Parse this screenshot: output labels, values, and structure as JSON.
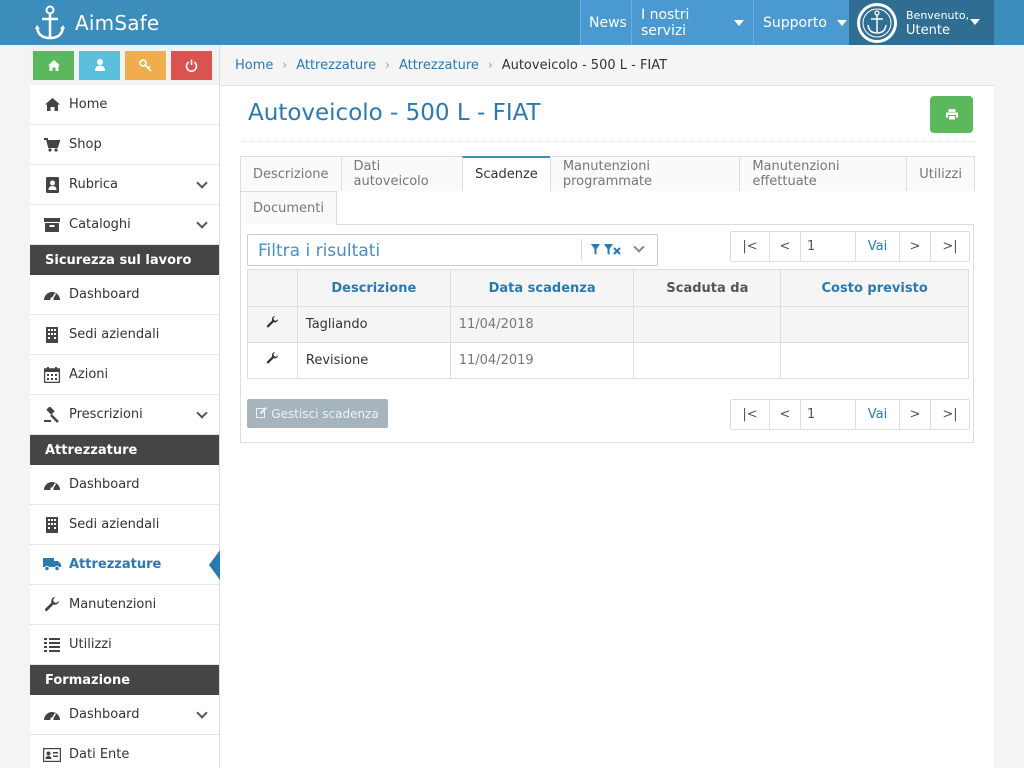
{
  "app": {
    "title": "AimSafe"
  },
  "topnav": {
    "items": [
      {
        "label": "News",
        "dropdown": false
      },
      {
        "label": "I nostri servizi",
        "dropdown": true
      },
      {
        "label": "Supporto",
        "dropdown": true
      }
    ],
    "user": {
      "greeting": "Benvenuto,",
      "name": "Utente"
    }
  },
  "quick_buttons": [
    {
      "icon": "home-icon",
      "color": "#5cb85c"
    },
    {
      "icon": "user-icon",
      "color": "#5bc0de"
    },
    {
      "icon": "key-icon",
      "color": "#f0ad4e"
    },
    {
      "icon": "power-icon",
      "color": "#d9534f"
    }
  ],
  "sidebar": {
    "top_items": [
      {
        "label": "Home",
        "icon": "home-icon"
      },
      {
        "label": "Shop",
        "icon": "cart-icon"
      },
      {
        "label": "Rubrica",
        "icon": "contact-book-icon",
        "expandable": true
      },
      {
        "label": "Cataloghi",
        "icon": "archive-icon",
        "expandable": true
      }
    ],
    "sections": [
      {
        "title": "Sicurezza sul lavoro",
        "items": [
          {
            "label": "Dashboard",
            "icon": "dashboard-icon"
          },
          {
            "label": "Sedi aziendali",
            "icon": "building-icon"
          },
          {
            "label": "Azioni",
            "icon": "calendar-icon"
          },
          {
            "label": "Prescrizioni",
            "icon": "gavel-icon",
            "expandable": true
          }
        ]
      },
      {
        "title": "Attrezzature",
        "items": [
          {
            "label": "Dashboard",
            "icon": "dashboard-icon"
          },
          {
            "label": "Sedi aziendali",
            "icon": "building-icon"
          },
          {
            "label": "Attrezzature",
            "icon": "truck-icon",
            "active": true
          },
          {
            "label": "Manutenzioni",
            "icon": "wrench-icon"
          },
          {
            "label": "Utilizzi",
            "icon": "list-icon"
          }
        ]
      },
      {
        "title": "Formazione",
        "items": [
          {
            "label": "Dashboard",
            "icon": "dashboard-icon",
            "expandable": true
          },
          {
            "label": "Dati Ente",
            "icon": "id-card-icon"
          }
        ]
      }
    ]
  },
  "breadcrumb": {
    "items": [
      "Home",
      "Attrezzature",
      "Attrezzature"
    ],
    "current": "Autoveicolo - 500 L - FIAT"
  },
  "page": {
    "title": "Autoveicolo - 500 L - FIAT"
  },
  "tabs": {
    "row1": [
      "Descrizione",
      "Dati autoveicolo",
      "Scadenze",
      "Manutenzioni programmate",
      "Manutenzioni effettuate",
      "Utilizzi"
    ],
    "row2": [
      "Documenti"
    ],
    "active": "Scadenze"
  },
  "filter": {
    "placeholder": "Filtra i risultati"
  },
  "pager": {
    "first": "|<",
    "prev": "<",
    "page": "1",
    "go": "Vai",
    "next": ">",
    "last": ">|"
  },
  "table": {
    "columns": [
      "Descrizione",
      "Data scadenza",
      "Scaduta da",
      "Costo previsto"
    ],
    "rows": [
      {
        "descrizione": "Tagliando",
        "data_scadenza": "11/04/2018",
        "scaduta_da": "",
        "costo_previsto": ""
      },
      {
        "descrizione": "Revisione",
        "data_scadenza": "11/04/2019",
        "scaduta_da": "",
        "costo_previsto": ""
      }
    ]
  },
  "actions": {
    "manage": "Gestisci scadenza"
  },
  "colors": {
    "primary": "#3c8dbc",
    "link": "#2a7ab0",
    "sidebar_section": "#454545",
    "print_button": "#5cb85c"
  }
}
